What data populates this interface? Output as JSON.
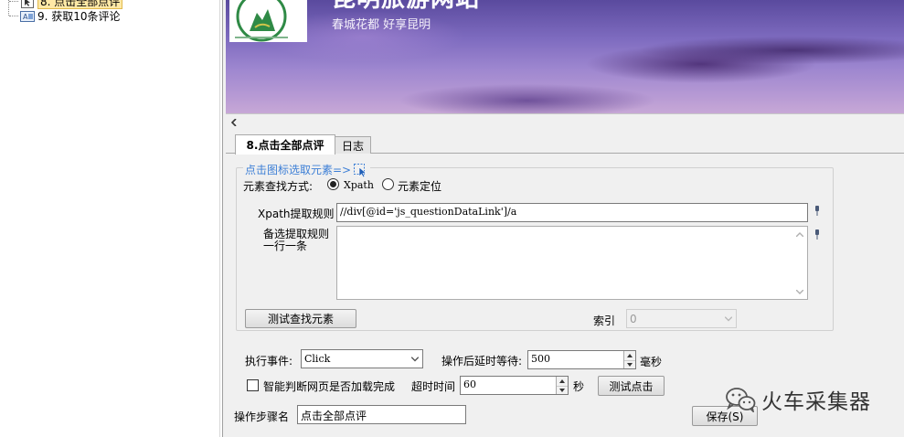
{
  "tree": {
    "items": [
      {
        "label": "8. 点击全部点评",
        "icon": "pointer-step-icon",
        "selected": true
      },
      {
        "label": "9. 获取10条评论",
        "icon": "extract-step-icon",
        "selected": false
      }
    ]
  },
  "banner": {
    "title": "昆明旅游网站",
    "subtitle": "春城花都 好享昆明"
  },
  "tabs": [
    {
      "label": "8.点击全部点评",
      "active": true
    },
    {
      "label": "日志",
      "active": false
    }
  ],
  "element_picker": {
    "legend": "点击图标选取元素=>",
    "method_label": "元素查找方式:",
    "method_options": [
      "Xpath",
      "元素定位"
    ],
    "method_selected": "Xpath",
    "xpath_label": "Xpath提取规则",
    "xpath_value": "//div[@id='js_questionDataLink']/a",
    "alt_rules_label_line1": "备选提取规则",
    "alt_rules_label_line2": "一行一条",
    "alt_rules_value": "",
    "test_find_button": "测试查找元素",
    "index_label": "索引",
    "index_value": "0"
  },
  "execution": {
    "event_label": "执行事件:",
    "event_value": "Click",
    "delay_label": "操作后延时等待:",
    "delay_value": "500",
    "delay_unit": "毫秒",
    "smart_wait_label": "智能判断网页是否加载完成",
    "smart_wait_checked": false,
    "timeout_label": "超时时间",
    "timeout_value": "60",
    "timeout_unit": "秒",
    "test_click_button": "测试点击"
  },
  "step": {
    "name_label": "操作步骤名",
    "name_value": "点击全部点评",
    "save_button": "保存(S)"
  },
  "watermark": {
    "text": "火车采集器",
    "icon": "wechat-icon"
  },
  "colors": {
    "legend_blue": "#3d7fd6",
    "selected_bg": "#ffe9a6"
  }
}
